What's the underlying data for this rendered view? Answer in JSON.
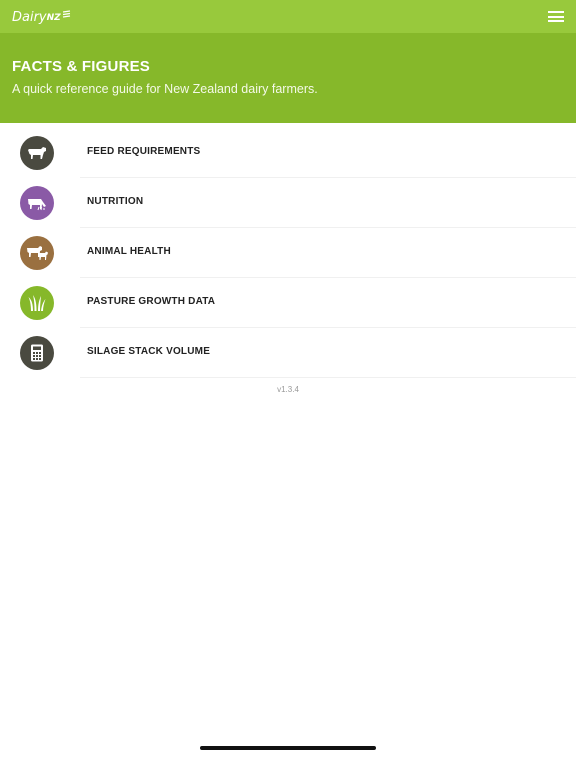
{
  "header": {
    "logo_text": "Dairy",
    "logo_suffix": "NZ"
  },
  "hero": {
    "title": "FACTS & FIGURES",
    "subtitle": "A quick reference guide for New Zealand dairy farmers."
  },
  "menu": {
    "items": [
      {
        "label": "FEED REQUIREMENTS",
        "icon": "cow-icon",
        "color": "#4a4a40"
      },
      {
        "label": "NUTRITION",
        "icon": "cow-grazing-icon",
        "color": "#8a5aa6"
      },
      {
        "label": "ANIMAL HEALTH",
        "icon": "cow-calf-icon",
        "color": "#9a7040"
      },
      {
        "label": "PASTURE GROWTH DATA",
        "icon": "grass-icon",
        "color": "#86b82a"
      },
      {
        "label": "SILAGE STACK VOLUME",
        "icon": "calculator-icon",
        "color": "#4a4a40"
      }
    ]
  },
  "footer": {
    "version": "v1.3.4"
  },
  "colors": {
    "topbar": "#98c93c",
    "hero": "#86b82a"
  }
}
